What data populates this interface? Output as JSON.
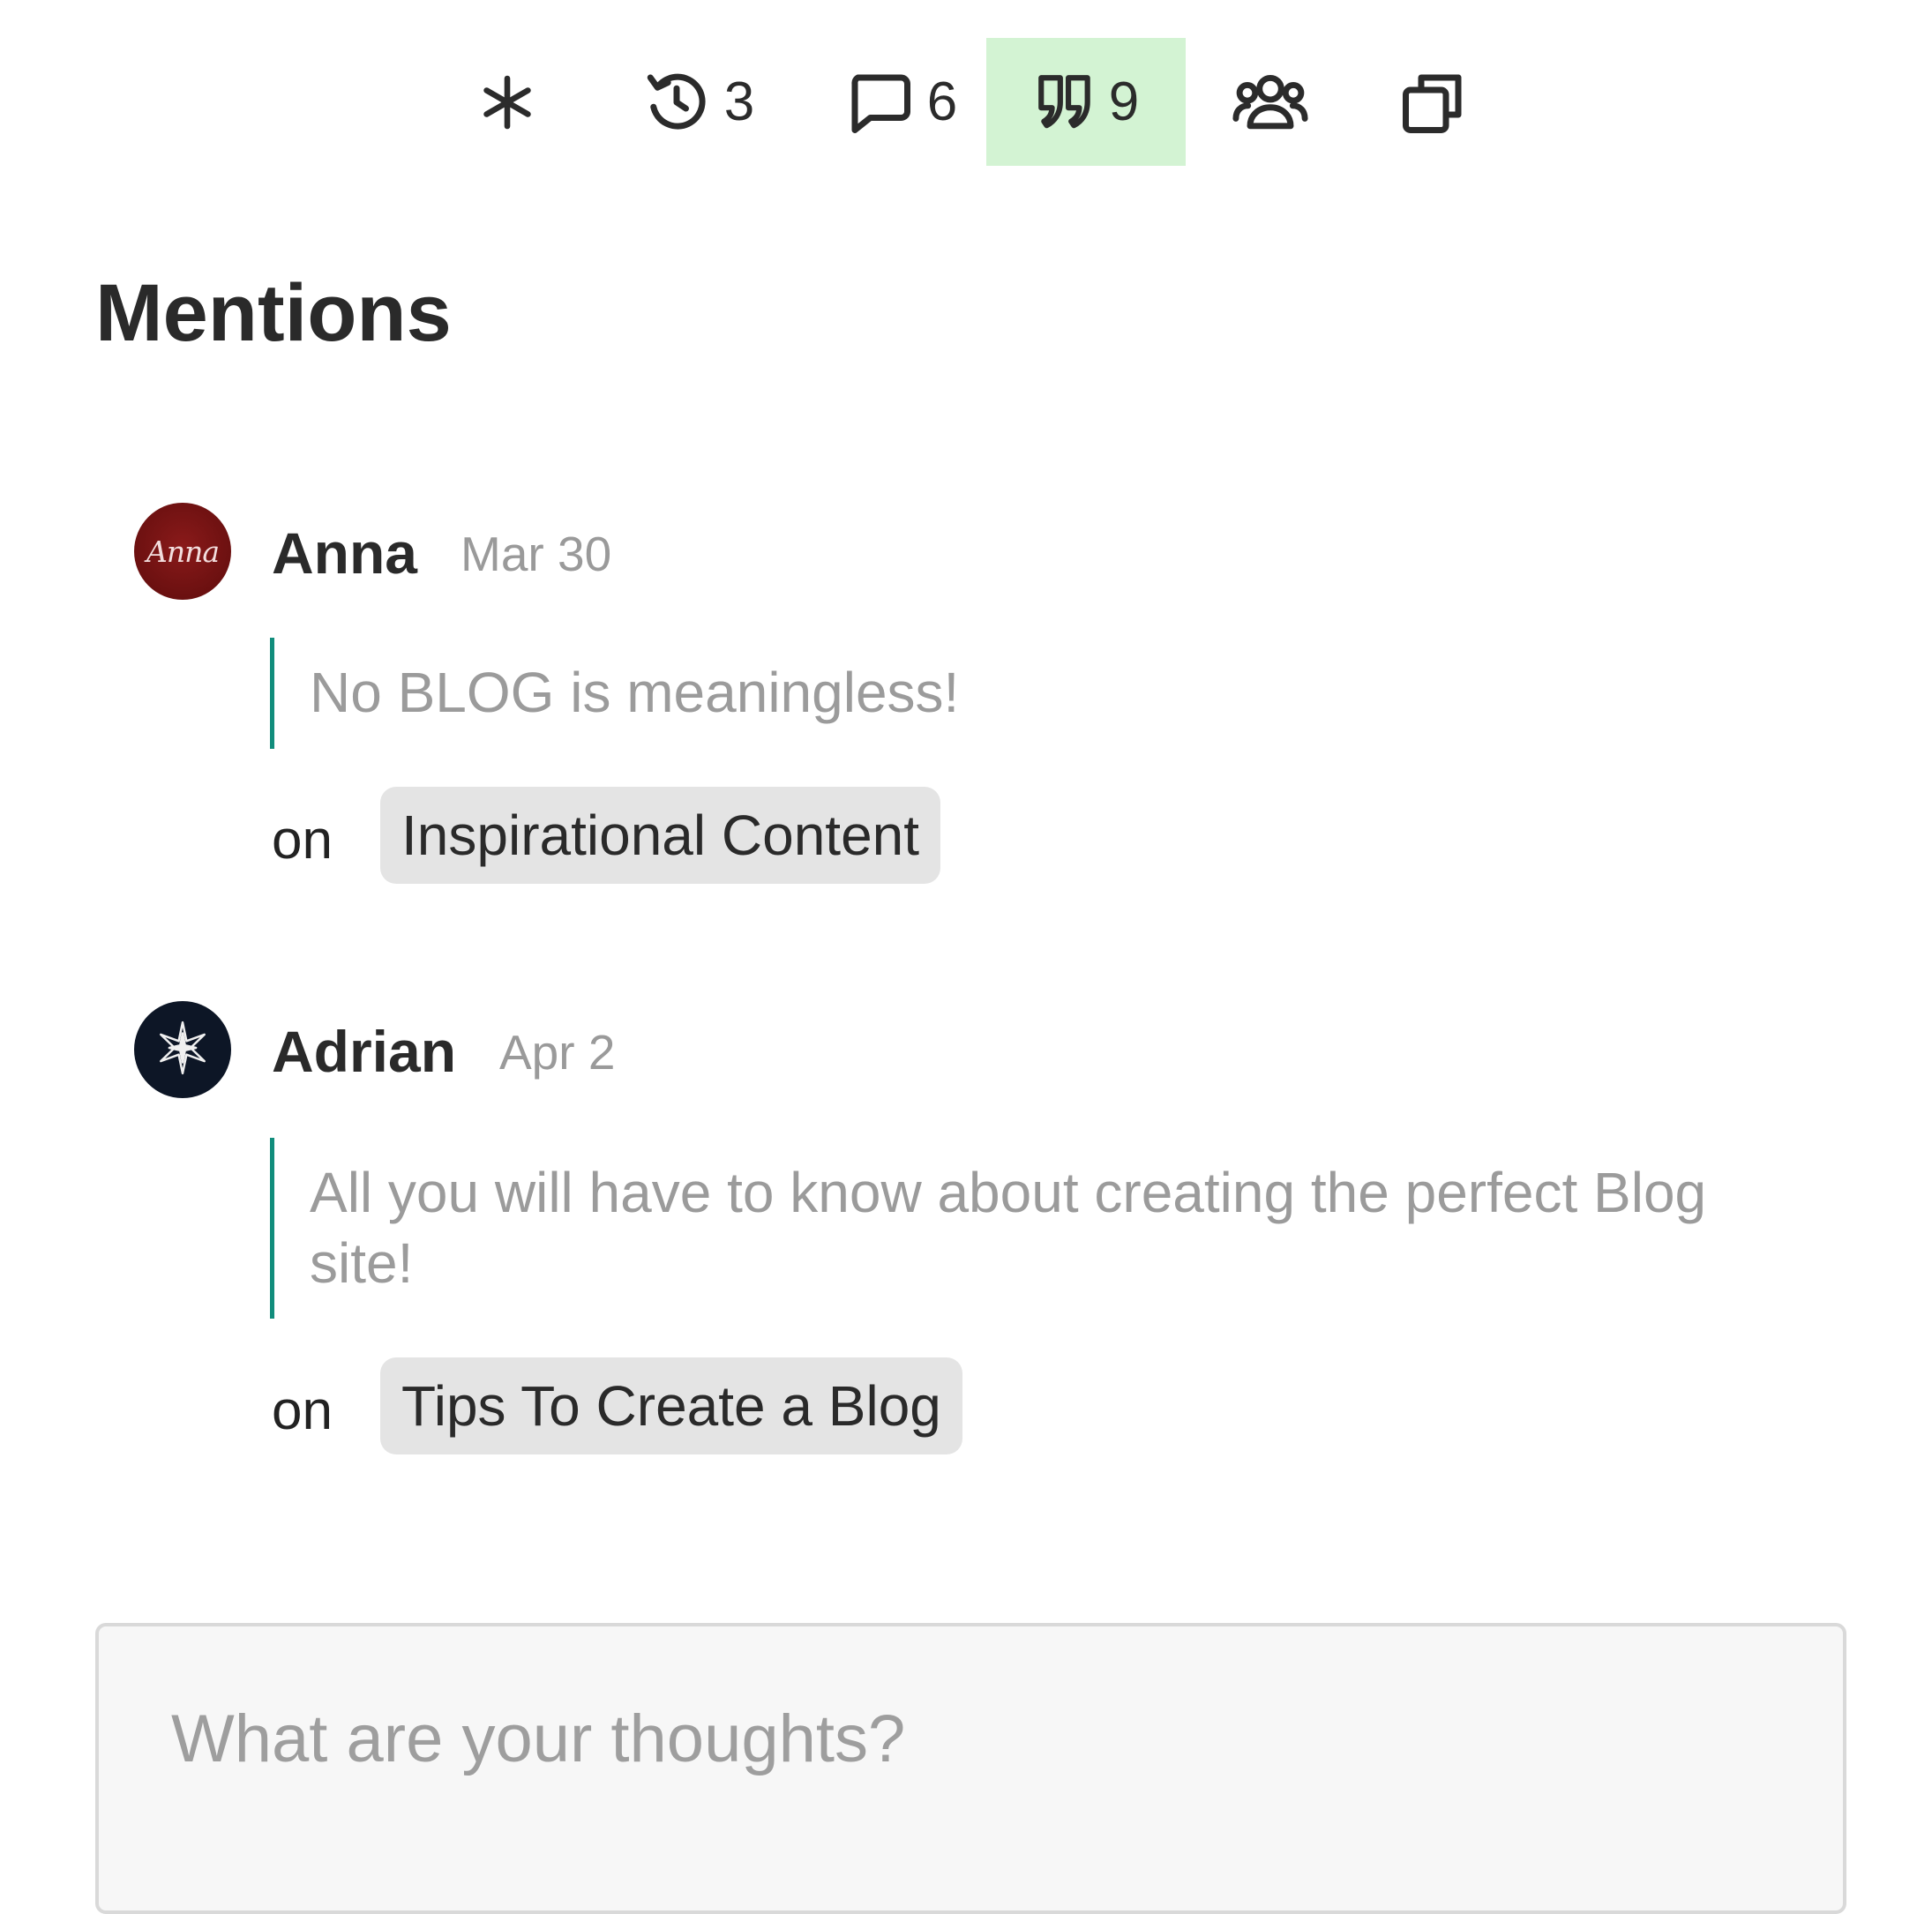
{
  "toolbar": {
    "items": [
      {
        "name": "overview",
        "icon": "asterisk-icon",
        "count": ""
      },
      {
        "name": "history",
        "icon": "history-icon",
        "count": "3"
      },
      {
        "name": "comments",
        "icon": "comment-icon",
        "count": "6"
      },
      {
        "name": "mentions",
        "icon": "quote-icon",
        "count": "9",
        "active": true
      },
      {
        "name": "users",
        "icon": "users-icon",
        "count": ""
      },
      {
        "name": "copies",
        "icon": "copy-icon",
        "count": ""
      }
    ],
    "active_color": "#d3f3d3"
  },
  "page": {
    "title": "Mentions"
  },
  "mentions": [
    {
      "author": "Anna",
      "avatar_text": "Anna",
      "date": "Mar 30",
      "quote": "No BLOG is meaningless!",
      "on_label": "on",
      "post": "Inspirational Content"
    },
    {
      "author": "Adrian",
      "date": "Apr 2",
      "quote": "All you will have to know about creating the perfect Blog site!",
      "on_label": "on",
      "post": "Tips To Create a Blog"
    }
  ],
  "comment": {
    "placeholder": "What are your thoughts?",
    "value": ""
  },
  "colors": {
    "quote_bar": "#118d7c",
    "chip_bg": "#e4e4e4",
    "muted_text": "#9b9b9b"
  }
}
